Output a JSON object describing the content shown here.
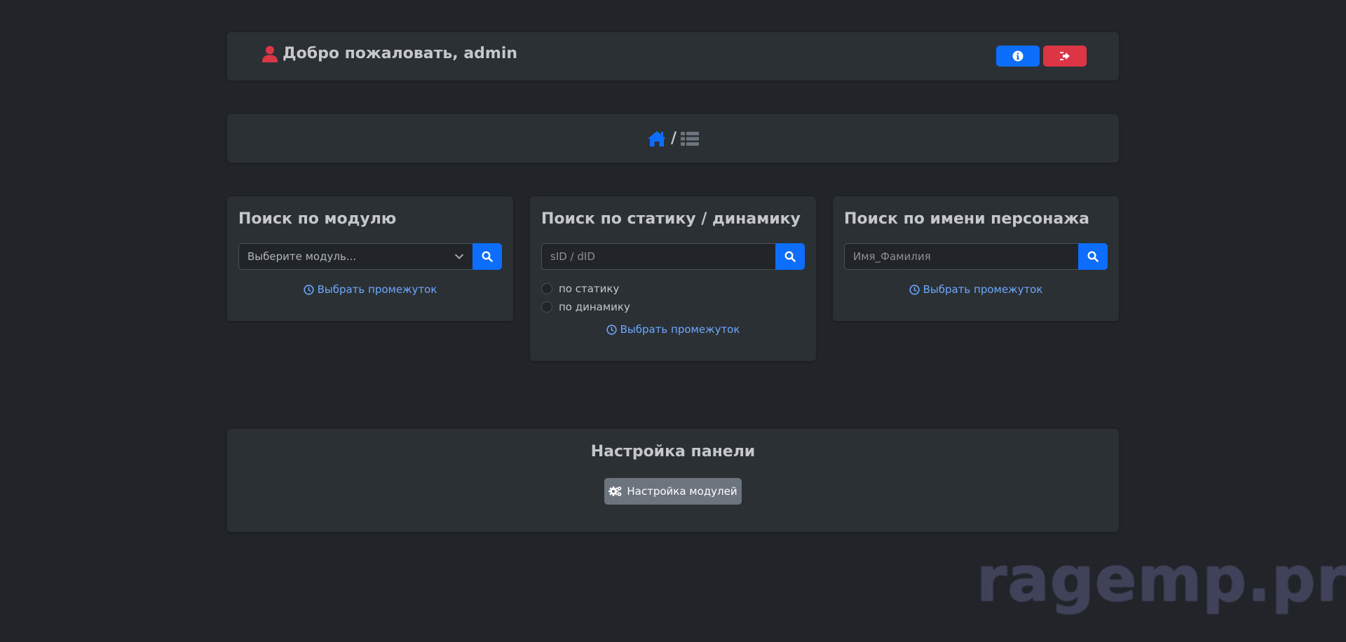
{
  "header": {
    "welcome_text": "Добро пожаловать, admin",
    "user_icon": "user-icon",
    "info_button_icon": "info-circle-icon",
    "logout_button_icon": "sign-out-icon"
  },
  "breadcrumb": {
    "home_icon": "home-icon",
    "separator": "/",
    "list_icon": "list-icon"
  },
  "cards": {
    "module": {
      "title": "Поиск по модулю",
      "select_value": "Выберите модуль...",
      "period_link": "Выбрать промежуток"
    },
    "static_dynamic": {
      "title": "Поиск по статику / динамику",
      "input_placeholder": "sID / dID",
      "radio_static": "по статику",
      "radio_dynamic": "по динамику",
      "period_link": "Выбрать промежуток"
    },
    "character": {
      "title": "Поиск по имени персонажа",
      "input_placeholder": "Имя_Фамилия",
      "period_link": "Выбрать промежуток"
    }
  },
  "settings": {
    "title": "Настройка панели",
    "button_label": "Настройка модулей",
    "button_icon": "cogs-icon"
  },
  "watermark": "ragemp.pro",
  "colors": {
    "background": "#212529",
    "panel": "#2b3035",
    "primary": "#0d6efd",
    "danger": "#dc3545",
    "secondary": "#6c757d",
    "link": "#6ea8fe"
  }
}
